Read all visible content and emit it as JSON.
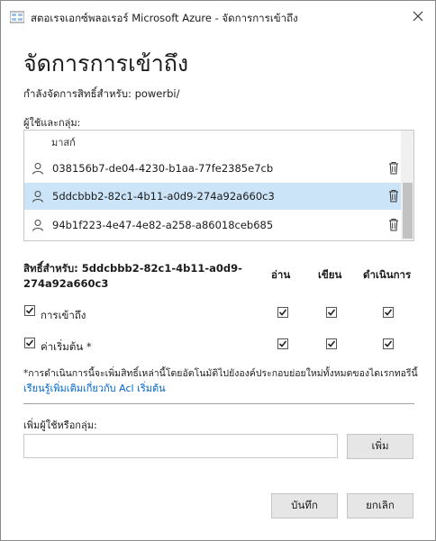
{
  "window": {
    "title": "สตอเรจเอกซ์พลอเรอร์ Microsoft Azure - จัดการการเข้าถึง"
  },
  "dialog": {
    "heading": "จัดการการเข้าถึง",
    "subtitle": "กำลังจัดการสิทธิ์สำหรับ: powerbi/",
    "users_label": "ผู้ใช้และกลุ่ม:",
    "list": {
      "partial_item": "มาสก์",
      "items": [
        {
          "id": "038156b7-de04-4230-b1aa-77fe2385e7cb",
          "selected": false
        },
        {
          "id": "5ddcbbb2-82c1-4b11-a0d9-274a92a660c3",
          "selected": true
        },
        {
          "id": "94b1f223-4e47-4e82-a258-a86018ceb685",
          "selected": false
        }
      ]
    },
    "permissions": {
      "title": "สิทธิ์สำหรับ: 5ddcbbb2-82c1-4b11-a0d9-274a92a660c3",
      "columns": [
        "อ่าน",
        "เขียน",
        "ดำเนินการ"
      ],
      "rows": [
        {
          "label": "การเข้าถึง",
          "enabled": true,
          "read": true,
          "write": true,
          "execute": true
        },
        {
          "label": "ค่าเริ่มต้น *",
          "enabled": true,
          "read": true,
          "write": true,
          "execute": true
        }
      ]
    },
    "note": "*การดำเนินการนี้จะเพิ่มสิทธิ์เหล่านี้โดยอัตโนมัติไปยังองค์ประกอบย่อยใหม่ทั้งหมดของไดเรกทอรีนี้",
    "learn_more": "เรียนรู้เพิ่มเติมเกี่ยวกับ Acl เริ่มต้น",
    "add_label": "เพิ่มผู้ใช้หรือกลุ่ม:",
    "add_input": {
      "value": "",
      "placeholder": ""
    },
    "add_button": "เพิ่ม",
    "save_button": "บันทึก",
    "cancel_button": "ยกเลิก"
  },
  "colors": {
    "selection": "#cce4f7",
    "link": "#0066cc",
    "button_bg": "#e6e6e6"
  },
  "icons": {
    "title": "storage-explorer-icon",
    "close": "close-icon",
    "user": "user-icon",
    "delete": "trash-icon",
    "check": "checkmark-icon"
  }
}
